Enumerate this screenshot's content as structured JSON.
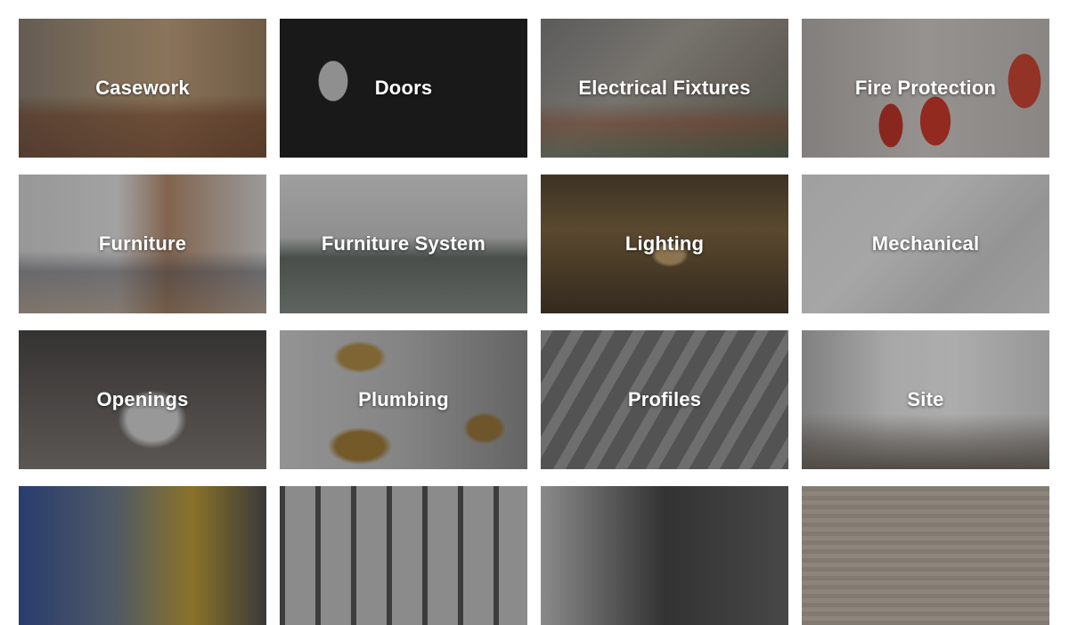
{
  "categories": [
    {
      "label": "Casework"
    },
    {
      "label": "Doors"
    },
    {
      "label": "Electrical Fixtures"
    },
    {
      "label": "Fire Protection"
    },
    {
      "label": "Furniture"
    },
    {
      "label": "Furniture System"
    },
    {
      "label": "Lighting"
    },
    {
      "label": "Mechanical"
    },
    {
      "label": "Openings"
    },
    {
      "label": "Plumbing"
    },
    {
      "label": "Profiles"
    },
    {
      "label": "Site"
    },
    {
      "label": ""
    },
    {
      "label": ""
    },
    {
      "label": ""
    },
    {
      "label": ""
    }
  ]
}
